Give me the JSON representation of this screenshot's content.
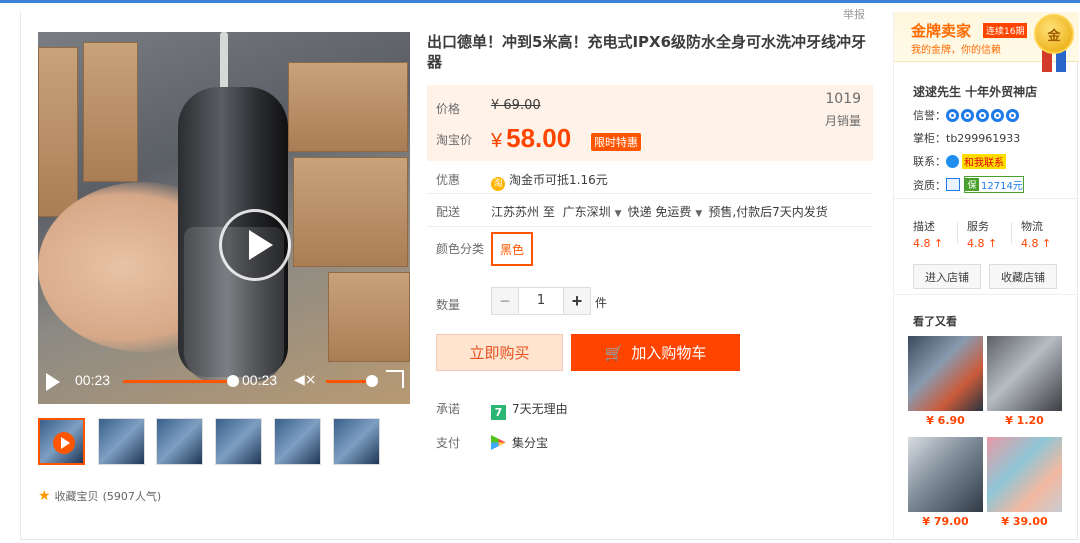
{
  "header": {
    "report_label": "举报"
  },
  "video": {
    "current_time": "00:23",
    "total_time": "00:23"
  },
  "favorite": {
    "label": "收藏宝贝",
    "count": "(5907人气)"
  },
  "product": {
    "title": "出口德单！冲到5米高！充电式IPX6级防水全身可水洗冲牙线冲牙器"
  },
  "price": {
    "label": "价格",
    "original": "¥ 69.00",
    "tb_label": "淘宝价",
    "currency": "¥",
    "current": "58.00",
    "badge": "限时特惠",
    "monthly_sales": "1019",
    "monthly_sales_label": "月销量"
  },
  "promo": {
    "label": "优惠",
    "coin": "淘",
    "text": "淘金币可抵1.16元"
  },
  "delivery": {
    "label": "配送",
    "from": "江苏苏州 至",
    "to": "广东深圳",
    "method": "快递 免运费",
    "presale": "预售,付款后7天内发货"
  },
  "color": {
    "label": "颜色分类",
    "selected": "黑色"
  },
  "quantity": {
    "label": "数量",
    "minus": "−",
    "value": "1",
    "plus": "+",
    "unit": "件"
  },
  "actions": {
    "buy_now": "立即购买",
    "add_cart": "加入购物车"
  },
  "promise": {
    "label": "承诺",
    "icon_text": "7",
    "text": "7天无理由"
  },
  "payment": {
    "label": "支付",
    "text": "集分宝"
  },
  "seller": {
    "gold_title": "金牌卖家",
    "gold_tag": "连续16期",
    "gold_sub": "我的金牌，你的信赖",
    "medal_char": "金",
    "shop_name": "逑逑先生 十年外贸神店",
    "credit_label": "信誉：",
    "credit_hearts": 5,
    "keeper_label": "掌柜：",
    "keeper": "tb299961933",
    "contact_label": "联系：",
    "contact_text": "和我联系",
    "qual_label": "资质：",
    "deposit": "12714元",
    "scores": [
      {
        "label": "描述",
        "value": "4.8 ↑"
      },
      {
        "label": "服务",
        "value": "4.8 ↑"
      },
      {
        "label": "物流",
        "value": "4.8 ↑"
      }
    ],
    "enter_shop": "进入店铺",
    "fav_shop": "收藏店铺"
  },
  "also_viewed": {
    "title": "看了又看",
    "items": [
      {
        "price": "¥ 6.90"
      },
      {
        "price": "¥ 1.20"
      },
      {
        "price": "¥ 79.00"
      },
      {
        "price": "¥ 39.00"
      }
    ]
  },
  "colors": {
    "accent": "#ff4400",
    "accent_light": "#ffe4d0",
    "price_bg": "#fff2e8",
    "top_bar": "#3d82d8"
  }
}
